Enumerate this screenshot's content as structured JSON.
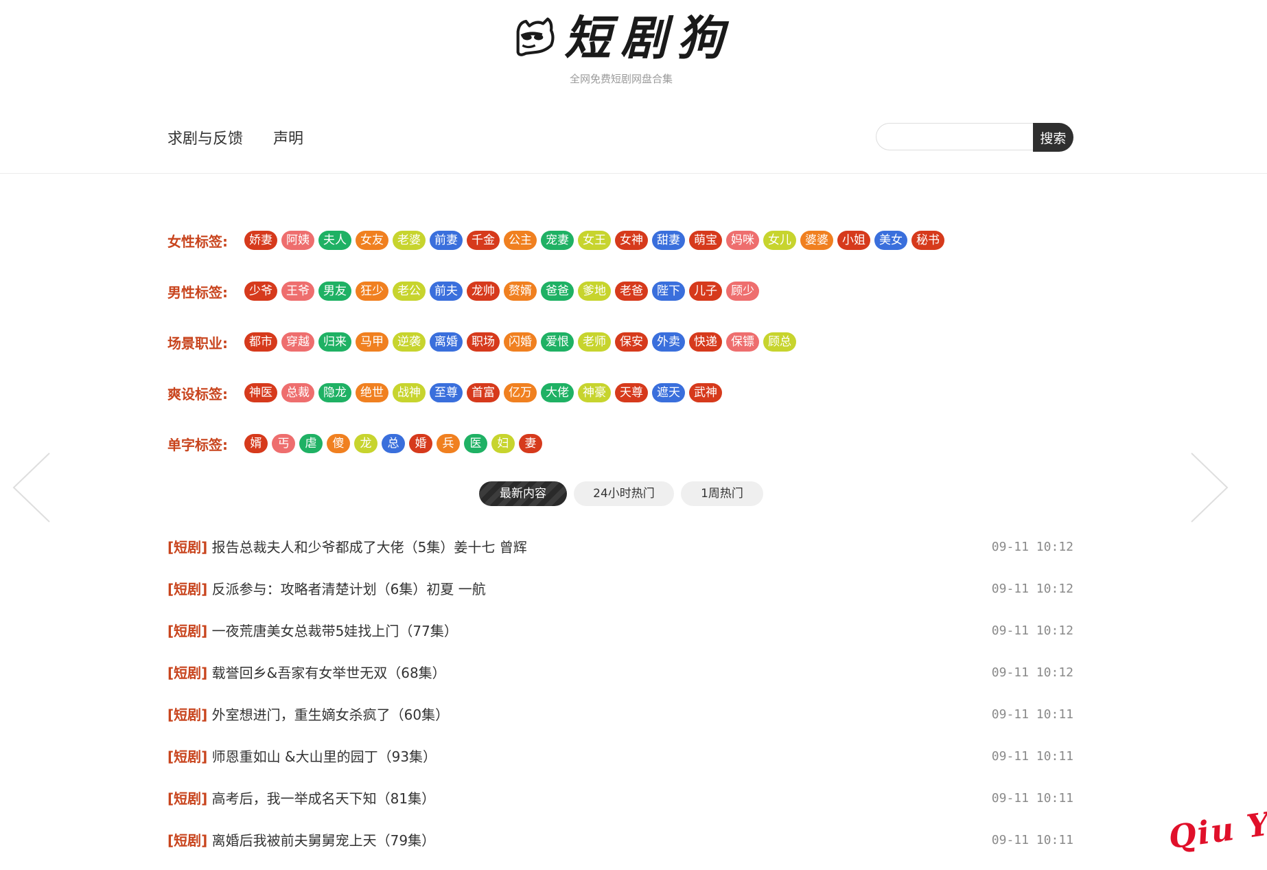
{
  "header": {
    "logo_text": "短剧狗",
    "slogan": "全网免费短剧网盘合集",
    "nav": [
      "求剧与反馈",
      "声明"
    ],
    "search": {
      "placeholder": "",
      "button_label": "搜索"
    }
  },
  "colors": {
    "accent": "#c8441d",
    "tag_red": "#d63a1c",
    "tag_pink": "#ee6e6e",
    "tag_green": "#1fb164",
    "tag_orange": "#f08020",
    "tag_lime": "#c7d42e",
    "tag_blue": "#3a6fdc"
  },
  "tag_groups": [
    {
      "label": "女性标签:",
      "tags": [
        {
          "text": "娇妻",
          "color": "#d63a1c"
        },
        {
          "text": "阿姨",
          "color": "#ee6e6e"
        },
        {
          "text": "夫人",
          "color": "#1fb164"
        },
        {
          "text": "女友",
          "color": "#f08020"
        },
        {
          "text": "老婆",
          "color": "#c7d42e"
        },
        {
          "text": "前妻",
          "color": "#3a6fdc"
        },
        {
          "text": "千金",
          "color": "#d63a1c"
        },
        {
          "text": "公主",
          "color": "#f08020"
        },
        {
          "text": "宠妻",
          "color": "#1fb164"
        },
        {
          "text": "女王",
          "color": "#c7d42e"
        },
        {
          "text": "女神",
          "color": "#d63a1c"
        },
        {
          "text": "甜妻",
          "color": "#3a6fdc"
        },
        {
          "text": "萌宝",
          "color": "#d63a1c"
        },
        {
          "text": "妈咪",
          "color": "#ee6e6e"
        },
        {
          "text": "女儿",
          "color": "#c7d42e"
        },
        {
          "text": "婆婆",
          "color": "#f08020"
        },
        {
          "text": "小姐",
          "color": "#d63a1c"
        },
        {
          "text": "美女",
          "color": "#3a6fdc"
        },
        {
          "text": "秘书",
          "color": "#d63a1c"
        }
      ]
    },
    {
      "label": "男性标签:",
      "tags": [
        {
          "text": "少爷",
          "color": "#d63a1c"
        },
        {
          "text": "王爷",
          "color": "#ee6e6e"
        },
        {
          "text": "男友",
          "color": "#1fb164"
        },
        {
          "text": "狂少",
          "color": "#f08020"
        },
        {
          "text": "老公",
          "color": "#c7d42e"
        },
        {
          "text": "前夫",
          "color": "#3a6fdc"
        },
        {
          "text": "龙帅",
          "color": "#d63a1c"
        },
        {
          "text": "赘婿",
          "color": "#f08020"
        },
        {
          "text": "爸爸",
          "color": "#1fb164"
        },
        {
          "text": "爹地",
          "color": "#c7d42e"
        },
        {
          "text": "老爸",
          "color": "#d63a1c"
        },
        {
          "text": "陛下",
          "color": "#3a6fdc"
        },
        {
          "text": "儿子",
          "color": "#d63a1c"
        },
        {
          "text": "顾少",
          "color": "#ee6e6e"
        }
      ]
    },
    {
      "label": "场景职业:",
      "tags": [
        {
          "text": "都市",
          "color": "#d63a1c"
        },
        {
          "text": "穿越",
          "color": "#ee6e6e"
        },
        {
          "text": "归来",
          "color": "#1fb164"
        },
        {
          "text": "马甲",
          "color": "#f08020"
        },
        {
          "text": "逆袭",
          "color": "#c7d42e"
        },
        {
          "text": "离婚",
          "color": "#3a6fdc"
        },
        {
          "text": "职场",
          "color": "#d63a1c"
        },
        {
          "text": "闪婚",
          "color": "#f08020"
        },
        {
          "text": "爱恨",
          "color": "#1fb164"
        },
        {
          "text": "老师",
          "color": "#c7d42e"
        },
        {
          "text": "保安",
          "color": "#d63a1c"
        },
        {
          "text": "外卖",
          "color": "#3a6fdc"
        },
        {
          "text": "快递",
          "color": "#d63a1c"
        },
        {
          "text": "保镖",
          "color": "#ee6e6e"
        },
        {
          "text": "顾总",
          "color": "#c7d42e"
        }
      ]
    },
    {
      "label": "爽设标签:",
      "tags": [
        {
          "text": "神医",
          "color": "#d63a1c"
        },
        {
          "text": "总裁",
          "color": "#ee6e6e"
        },
        {
          "text": "隐龙",
          "color": "#1fb164"
        },
        {
          "text": "绝世",
          "color": "#f08020"
        },
        {
          "text": "战神",
          "color": "#c7d42e"
        },
        {
          "text": "至尊",
          "color": "#3a6fdc"
        },
        {
          "text": "首富",
          "color": "#d63a1c"
        },
        {
          "text": "亿万",
          "color": "#f08020"
        },
        {
          "text": "大佬",
          "color": "#1fb164"
        },
        {
          "text": "神豪",
          "color": "#c7d42e"
        },
        {
          "text": "天尊",
          "color": "#d63a1c"
        },
        {
          "text": "遮天",
          "color": "#3a6fdc"
        },
        {
          "text": "武神",
          "color": "#d63a1c"
        }
      ]
    },
    {
      "label": "单字标签:",
      "tags": [
        {
          "text": "婿",
          "color": "#d63a1c"
        },
        {
          "text": "丐",
          "color": "#ee6e6e"
        },
        {
          "text": "虐",
          "color": "#1fb164"
        },
        {
          "text": "傻",
          "color": "#f08020"
        },
        {
          "text": "龙",
          "color": "#c7d42e"
        },
        {
          "text": "总",
          "color": "#3a6fdc"
        },
        {
          "text": "婚",
          "color": "#d63a1c"
        },
        {
          "text": "兵",
          "color": "#f08020"
        },
        {
          "text": "医",
          "color": "#1fb164"
        },
        {
          "text": "妇",
          "color": "#c7d42e"
        },
        {
          "text": "妻",
          "color": "#d63a1c"
        }
      ]
    }
  ],
  "tabs": [
    {
      "label": "最新内容",
      "active": true
    },
    {
      "label": "24小时热门",
      "active": false
    },
    {
      "label": "1周热门",
      "active": false
    }
  ],
  "list": [
    {
      "category": "[短剧]",
      "title": "报告总裁夫人和少爷都成了大佬（5集）姜十七 曾辉",
      "time": "09-11 10:12"
    },
    {
      "category": "[短剧]",
      "title": "反派参与：攻略者清楚计划（6集）初夏 一航",
      "time": "09-11 10:12"
    },
    {
      "category": "[短剧]",
      "title": "一夜荒唐美女总裁带5娃找上门（77集）",
      "time": "09-11 10:12"
    },
    {
      "category": "[短剧]",
      "title": "载誉回乡&吾家有女举世无双（68集）",
      "time": "09-11 10:12"
    },
    {
      "category": "[短剧]",
      "title": "外室想进门，重生嫡女杀疯了（60集）",
      "time": "09-11 10:11"
    },
    {
      "category": "[短剧]",
      "title": "师恩重如山 &大山里的园丁（93集）",
      "time": "09-11 10:11"
    },
    {
      "category": "[短剧]",
      "title": "高考后，我一举成名天下知（81集）",
      "time": "09-11 10:11"
    },
    {
      "category": "[短剧]",
      "title": "离婚后我被前夫舅舅宠上天（79集）",
      "time": "09-11 10:11"
    }
  ],
  "watermark": "Qiu Yue",
  "icons": {
    "logo": "dog-face-logo",
    "prev": "chevron-left-icon",
    "next": "chevron-right-icon"
  }
}
